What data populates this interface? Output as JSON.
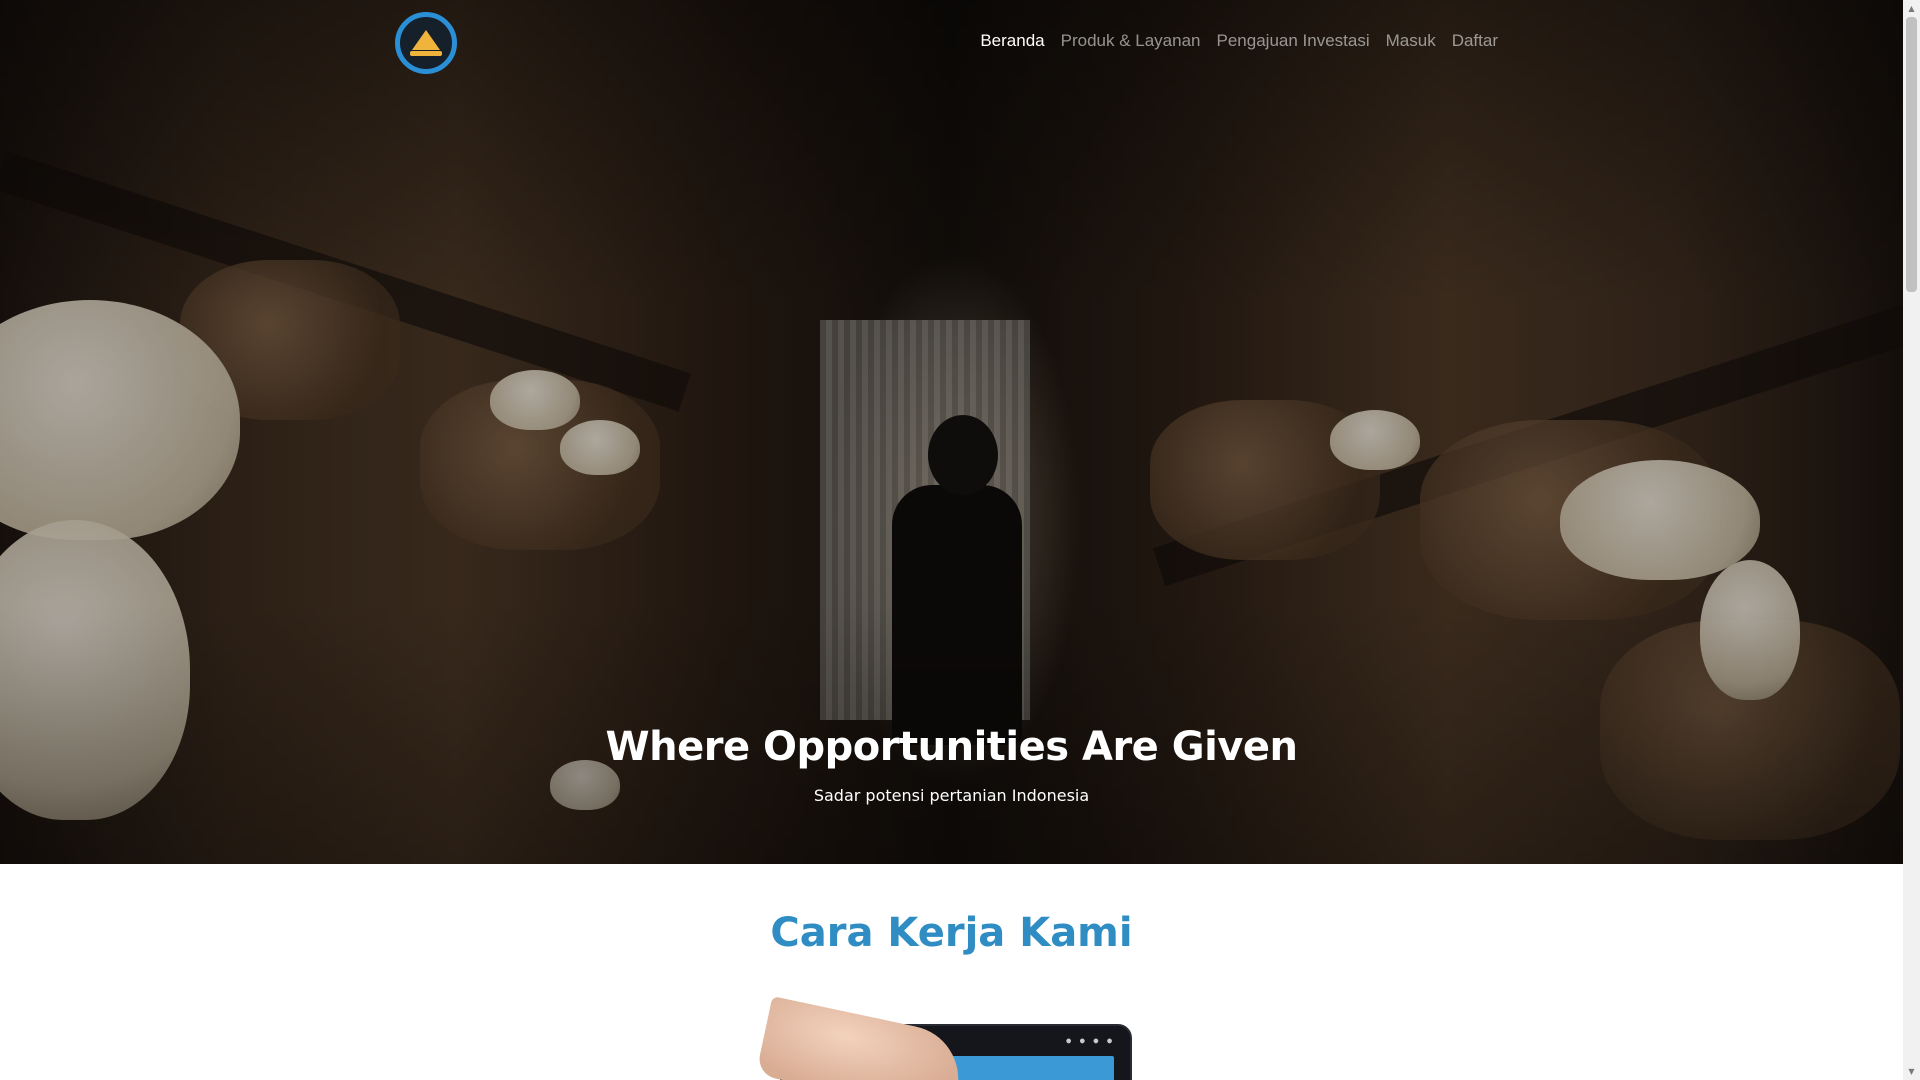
{
  "nav": {
    "items": [
      {
        "label": "Beranda",
        "active": true
      },
      {
        "label": "Produk & Layanan",
        "active": false
      },
      {
        "label": "Pengajuan Investasi",
        "active": false
      },
      {
        "label": "Masuk",
        "active": false
      },
      {
        "label": "Daftar",
        "active": false
      }
    ]
  },
  "hero": {
    "title": "Where Opportunities Are Given",
    "subtitle": "Sadar potensi pertanian Indonesia"
  },
  "section": {
    "title": "Cara Kerja Kami"
  },
  "colors": {
    "accent": "#2f8dc3",
    "logo_ring": "#2b8fd6",
    "logo_mark": "#f0b43c"
  },
  "icons": {
    "logo": "brand-logo-icon",
    "scroll_up": "scroll-up-arrow-icon",
    "scroll_down": "scroll-down-arrow-icon"
  }
}
